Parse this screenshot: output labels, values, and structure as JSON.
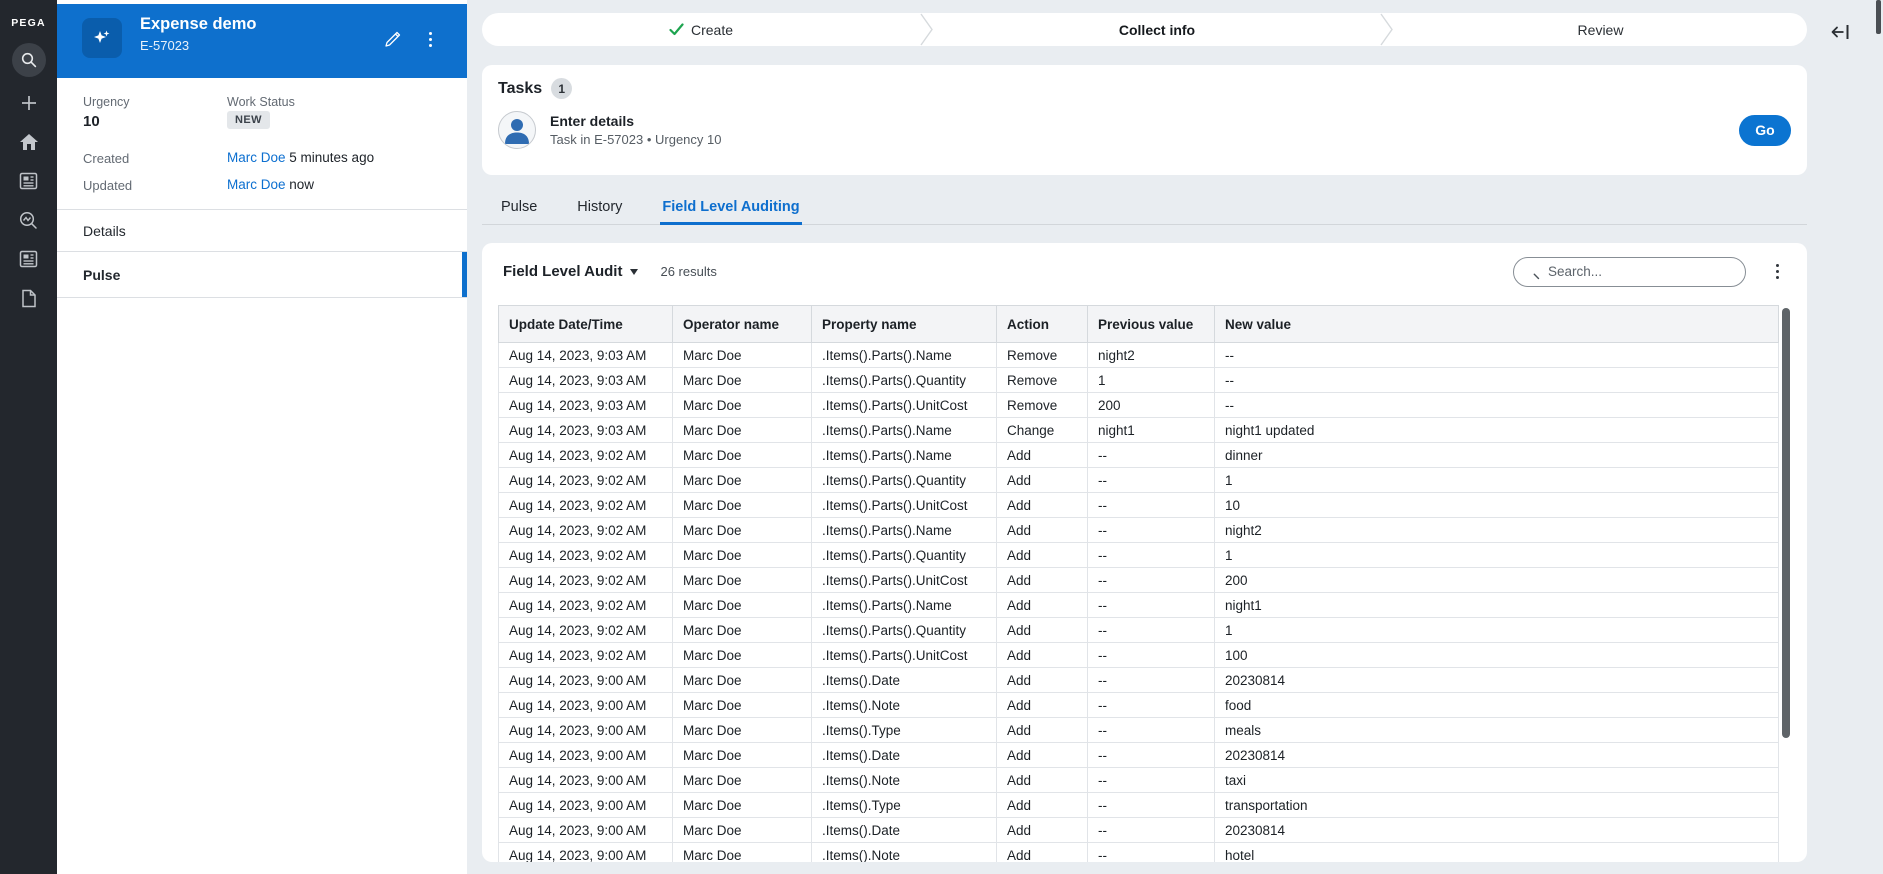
{
  "colors": {
    "sidebar_bg": "#23272d",
    "case_header_blue": "#0e70cd",
    "case_tile_blue": "#0a5dac",
    "link_blue": "#0c6fd0",
    "active_tab_blue": "#0e6fce",
    "go_button_blue": "#0b74d1",
    "check_green": "#1ea450",
    "page_bg": "#e9edf1",
    "badge_gray": "#e4e7ea"
  },
  "rail": {
    "brand": "PEGA",
    "items": [
      {
        "icon": "search-icon"
      },
      {
        "icon": "plus-icon"
      },
      {
        "icon": "home-icon"
      },
      {
        "icon": "news-icon"
      },
      {
        "icon": "insights-icon"
      },
      {
        "icon": "reports-icon"
      },
      {
        "icon": "document-icon"
      }
    ]
  },
  "case_panel": {
    "title": "Expense demo",
    "id": "E-57023",
    "icons": {
      "edit": "pencil-icon",
      "more": "kebab-icon",
      "tile": "sparkle-icon"
    },
    "fields": {
      "urgency_label": "Urgency",
      "urgency_value": "10",
      "work_status_label": "Work Status",
      "work_status_value": "NEW",
      "created_label": "Created",
      "created_user": "Marc Doe",
      "created_time": "5 minutes ago",
      "updated_label": "Updated",
      "updated_user": "Marc Doe",
      "updated_time": "now"
    },
    "nav": [
      {
        "label": "Details",
        "selected": false
      },
      {
        "label": "Pulse",
        "selected": true
      }
    ]
  },
  "stepper": {
    "steps": [
      {
        "label": "Create",
        "state": "done"
      },
      {
        "label": "Collect info",
        "state": "current"
      },
      {
        "label": "Review",
        "state": "upcoming"
      }
    ]
  },
  "tasks": {
    "title": "Tasks",
    "count": "1",
    "item": {
      "name": "Enter details",
      "meta": "Task in E-57023 • Urgency 10",
      "action_label": "Go"
    }
  },
  "tabs": [
    {
      "label": "Pulse",
      "active": false
    },
    {
      "label": "History",
      "active": false
    },
    {
      "label": "Field Level Auditing",
      "active": true
    }
  ],
  "audit": {
    "title": "Field Level Audit",
    "results_text": "26 results",
    "search_placeholder": "Search...",
    "columns": [
      {
        "label": "Update Date/Time"
      },
      {
        "label": "Operator name"
      },
      {
        "label": "Property name"
      },
      {
        "label": "Action"
      },
      {
        "label": "Previous value"
      },
      {
        "label": "New value"
      }
    ],
    "rows": [
      {
        "date": "Aug 14, 2023, 9:03 AM",
        "operator": "Marc Doe",
        "property": ".Items().Parts().Name",
        "action": "Remove",
        "previous": "night2",
        "new_value": "--"
      },
      {
        "date": "Aug 14, 2023, 9:03 AM",
        "operator": "Marc Doe",
        "property": ".Items().Parts().Quantity",
        "action": "Remove",
        "previous": "1",
        "new_value": "--"
      },
      {
        "date": "Aug 14, 2023, 9:03 AM",
        "operator": "Marc Doe",
        "property": ".Items().Parts().UnitCost",
        "action": "Remove",
        "previous": "200",
        "new_value": "--"
      },
      {
        "date": "Aug 14, 2023, 9:03 AM",
        "operator": "Marc Doe",
        "property": ".Items().Parts().Name",
        "action": "Change",
        "previous": "night1",
        "new_value": "night1 updated"
      },
      {
        "date": "Aug 14, 2023, 9:02 AM",
        "operator": "Marc Doe",
        "property": ".Items().Parts().Name",
        "action": "Add",
        "previous": "--",
        "new_value": "dinner"
      },
      {
        "date": "Aug 14, 2023, 9:02 AM",
        "operator": "Marc Doe",
        "property": ".Items().Parts().Quantity",
        "action": "Add",
        "previous": "--",
        "new_value": "1"
      },
      {
        "date": "Aug 14, 2023, 9:02 AM",
        "operator": "Marc Doe",
        "property": ".Items().Parts().UnitCost",
        "action": "Add",
        "previous": "--",
        "new_value": "10"
      },
      {
        "date": "Aug 14, 2023, 9:02 AM",
        "operator": "Marc Doe",
        "property": ".Items().Parts().Name",
        "action": "Add",
        "previous": "--",
        "new_value": "night2"
      },
      {
        "date": "Aug 14, 2023, 9:02 AM",
        "operator": "Marc Doe",
        "property": ".Items().Parts().Quantity",
        "action": "Add",
        "previous": "--",
        "new_value": "1"
      },
      {
        "date": "Aug 14, 2023, 9:02 AM",
        "operator": "Marc Doe",
        "property": ".Items().Parts().UnitCost",
        "action": "Add",
        "previous": "--",
        "new_value": "200"
      },
      {
        "date": "Aug 14, 2023, 9:02 AM",
        "operator": "Marc Doe",
        "property": ".Items().Parts().Name",
        "action": "Add",
        "previous": "--",
        "new_value": "night1"
      },
      {
        "date": "Aug 14, 2023, 9:02 AM",
        "operator": "Marc Doe",
        "property": ".Items().Parts().Quantity",
        "action": "Add",
        "previous": "--",
        "new_value": "1"
      },
      {
        "date": "Aug 14, 2023, 9:02 AM",
        "operator": "Marc Doe",
        "property": ".Items().Parts().UnitCost",
        "action": "Add",
        "previous": "--",
        "new_value": "100"
      },
      {
        "date": "Aug 14, 2023, 9:00 AM",
        "operator": "Marc Doe",
        "property": ".Items().Date",
        "action": "Add",
        "previous": "--",
        "new_value": "20230814"
      },
      {
        "date": "Aug 14, 2023, 9:00 AM",
        "operator": "Marc Doe",
        "property": ".Items().Note",
        "action": "Add",
        "previous": "--",
        "new_value": "food"
      },
      {
        "date": "Aug 14, 2023, 9:00 AM",
        "operator": "Marc Doe",
        "property": ".Items().Type",
        "action": "Add",
        "previous": "--",
        "new_value": "meals"
      },
      {
        "date": "Aug 14, 2023, 9:00 AM",
        "operator": "Marc Doe",
        "property": ".Items().Date",
        "action": "Add",
        "previous": "--",
        "new_value": "20230814"
      },
      {
        "date": "Aug 14, 2023, 9:00 AM",
        "operator": "Marc Doe",
        "property": ".Items().Note",
        "action": "Add",
        "previous": "--",
        "new_value": "taxi"
      },
      {
        "date": "Aug 14, 2023, 9:00 AM",
        "operator": "Marc Doe",
        "property": ".Items().Type",
        "action": "Add",
        "previous": "--",
        "new_value": "transportation"
      },
      {
        "date": "Aug 14, 2023, 9:00 AM",
        "operator": "Marc Doe",
        "property": ".Items().Date",
        "action": "Add",
        "previous": "--",
        "new_value": "20230814"
      },
      {
        "date": "Aug 14, 2023, 9:00 AM",
        "operator": "Marc Doe",
        "property": ".Items().Note",
        "action": "Add",
        "previous": "--",
        "new_value": "hotel"
      }
    ]
  }
}
